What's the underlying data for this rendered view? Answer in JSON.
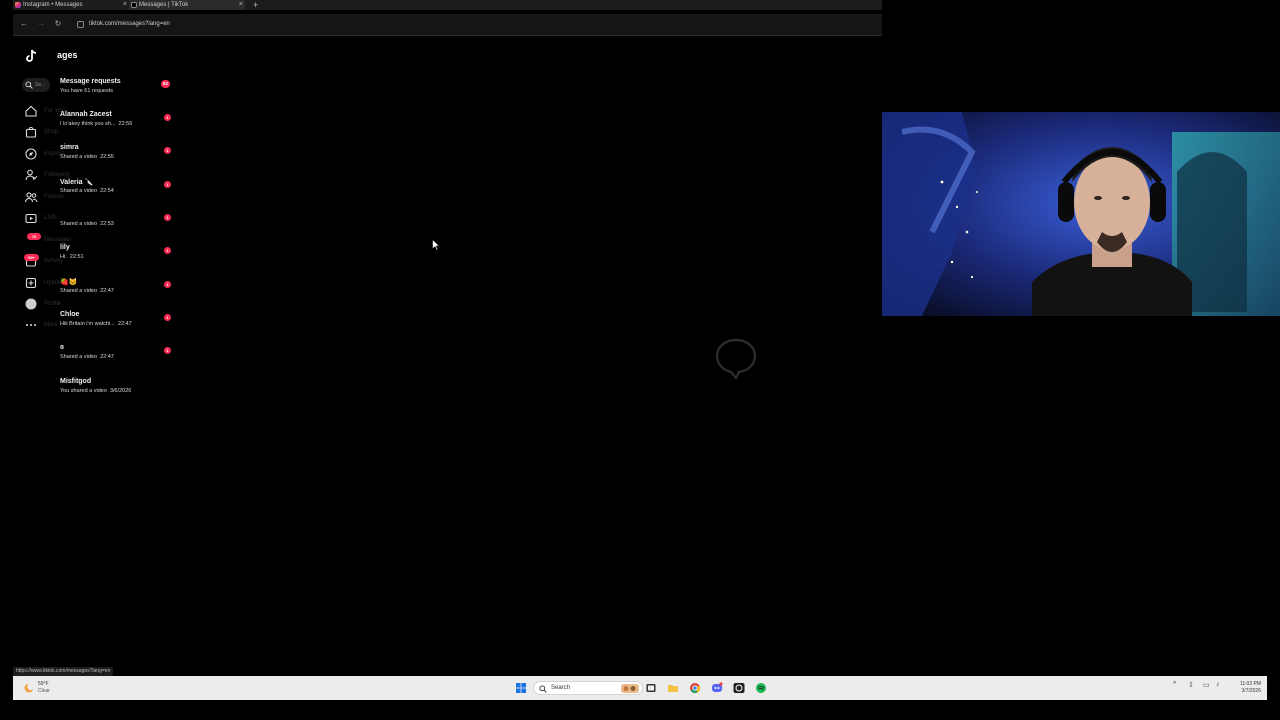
{
  "browser": {
    "tabs": [
      {
        "title": "Instagram • Messages"
      },
      {
        "title": "Messages | TikTok"
      }
    ],
    "new_tab": "+",
    "url": "tiktok.com/messages?lang=en",
    "status_url": "https://www.tiktok.com/messages?lang=en"
  },
  "tiktok": {
    "page_title": "ages",
    "search_placeholder": "Se...",
    "nav_ghost_labels": [
      "For You",
      "Shop",
      "Explore",
      "Following",
      "Friends",
      "LIVE",
      "Messages",
      "Activity",
      "Upload",
      "Profile",
      "More"
    ],
    "badges": {
      "messages": "70",
      "activity": "99+"
    },
    "conversations": [
      {
        "name": "Message requests",
        "preview": "You have 61 requests",
        "time": "",
        "badge": "62"
      },
      {
        "name": "Alannah Zacest",
        "preview": "I lo'akey think you sh...",
        "time": "22:56",
        "badge": "1"
      },
      {
        "name": "simra",
        "preview": "Shared a video",
        "time": "22:55",
        "badge": "1"
      },
      {
        "name": "Valeria 🔪",
        "preview": "Shared a video",
        "time": "22:54",
        "badge": "1"
      },
      {
        "name": "",
        "preview": "Shared a video",
        "time": "22:53",
        "badge": "1"
      },
      {
        "name": "lily",
        "preview": "Hi.",
        "time": "22:51",
        "badge": "1"
      },
      {
        "name": "🍓🐱",
        "preview": "Shared a video",
        "time": "22:47",
        "badge": "1"
      },
      {
        "name": "Chloe",
        "preview": "Hiii Britain i'm watchi...",
        "time": "22:47",
        "badge": "1"
      },
      {
        "name": "ɞ",
        "preview": "Shared a video",
        "time": "22:47",
        "badge": "1"
      },
      {
        "name": "Misfitgod",
        "preview": "You shared a video",
        "time": "3/6/2026",
        "badge": ""
      }
    ]
  },
  "taskbar": {
    "weather_temp": "59°F",
    "weather_cond": "Clear",
    "search_label": "Search",
    "time": "11:02 PM",
    "date": "3/7/2026"
  },
  "colors": {
    "accent": "#fe2c55",
    "background": "#000000",
    "taskbar": "#ececec"
  }
}
